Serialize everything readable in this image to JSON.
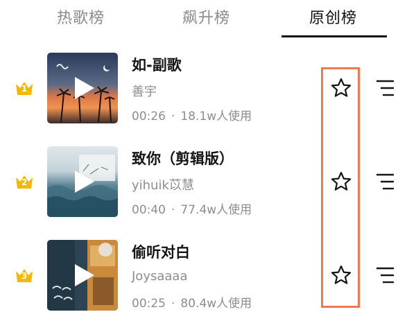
{
  "tabs": [
    {
      "label": "热歌榜"
    },
    {
      "label": "飙升榜"
    },
    {
      "label": "原创榜"
    }
  ],
  "active_tab": "原创榜",
  "songs": [
    {
      "rank": "1",
      "title": "如-副歌",
      "artist": "善宇",
      "duration": "00:26",
      "separator": "·",
      "uses": "18.1w人使用"
    },
    {
      "rank": "2",
      "title": "致你（剪辑版）",
      "artist": "yihuik苡慧",
      "duration": "00:40",
      "separator": "·",
      "uses": "77.4w人使用"
    },
    {
      "rank": "3",
      "title": "偷听对白",
      "artist": "Joysaaaa",
      "duration": "00:25",
      "separator": "·",
      "uses": "80.4w人使用"
    }
  ],
  "colors": {
    "crown": "#f5b800",
    "highlight_border": "#f07a4f",
    "active_tab": "#111111",
    "inactive_tab": "#8a8a8a"
  },
  "icons": {
    "favorite": "star-outline-icon",
    "more": "list-menu-icon",
    "play": "play-icon",
    "rank_badge": "crown-icon"
  }
}
